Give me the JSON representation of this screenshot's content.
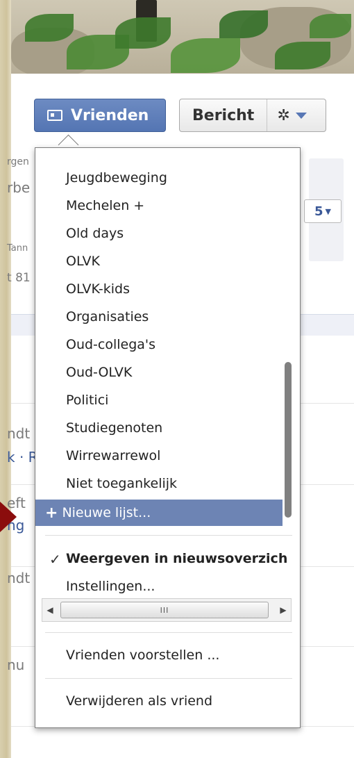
{
  "header": {
    "friends_button_label": "Vrienden",
    "message_button_label": "Bericht",
    "gear_symbol": "✲"
  },
  "behind": {
    "badge_count": "5",
    "ghost_texts": [
      "rgen",
      "rbe",
      "Tann",
      "t 81",
      "ndt",
      "k · R",
      "eft",
      "ng",
      "ndt",
      "nu"
    ]
  },
  "menu": {
    "lists": [
      "Jeugdbeweging",
      "Mechelen +",
      "Old days",
      "OLVK",
      "OLVK-kids",
      "Organisaties",
      "Oud-collega's",
      "Oud-OLVK",
      "Politici",
      "Studiegenoten",
      "Wirrewarrewol",
      "Niet toegankelijk"
    ],
    "new_list_label": "Nieuwe lijst...",
    "show_in_newsfeed_label": "Weergeven in nieuwsoverzich",
    "show_in_newsfeed_checked": true,
    "settings_label": "Instellingen...",
    "suggest_friends_label": "Vrienden voorstellen ...",
    "remove_friend_label": "Verwijderen als vriend",
    "hscroll_grip": "III"
  },
  "colors": {
    "selected_bg": "#6d84b4",
    "friends_button": "#5b7bb8",
    "arrow": "#8b0d0d"
  }
}
